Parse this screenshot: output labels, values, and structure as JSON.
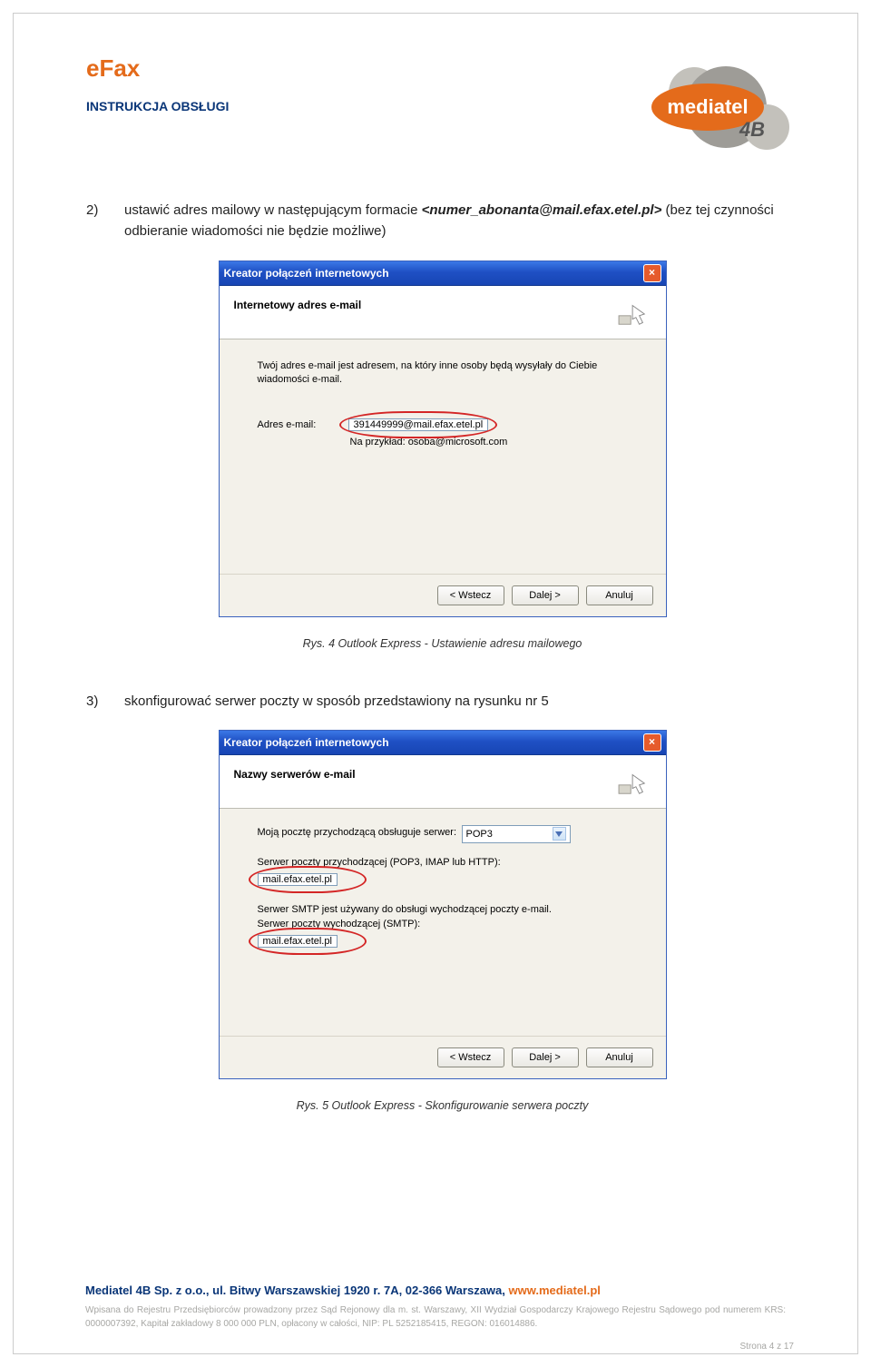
{
  "header": {
    "title": "eFax",
    "subtitle": "INSTRUKCJA OBSŁUGI",
    "logo_main": "mediatel",
    "logo_sub": "4B"
  },
  "step2": {
    "num": "2)",
    "text_a": "ustawić adres mailowy w następującym formacie ",
    "text_italic": "<numer_abonanta@mail.efax.etel.pl>",
    "text_b": " (bez tej czynności odbieranie wiadomości nie będzie możliwe)"
  },
  "dialog1": {
    "title": "Kreator połączeń internetowych",
    "header": "Internetowy adres e-mail",
    "hint": "Twój adres e-mail jest adresem, na który inne osoby będą wysyłały do Ciebie wiadomości e-mail.",
    "field_label": "Adres e-mail:",
    "field_value": "391449999@mail.efax.etel.pl",
    "example": "Na przykład: osoba@microsoft.com",
    "btn_back": "< Wstecz",
    "btn_next": "Dalej >",
    "btn_cancel": "Anuluj",
    "close": "×"
  },
  "caption1": "Rys. 4 Outlook Express - Ustawienie adresu mailowego",
  "step3": {
    "num": "3)",
    "text": "skonfigurować serwer poczty w sposób przedstawiony na rysunku nr 5"
  },
  "dialog2": {
    "title": "Kreator połączeń internetowych",
    "header": "Nazwy serwerów e-mail",
    "label_incoming_proto": "Moją pocztę przychodzącą obsługuje serwer:",
    "proto_value": "POP3",
    "label_incoming": "Serwer poczty przychodzącej (POP3, IMAP lub HTTP):",
    "incoming_value": "mail.efax.etel.pl",
    "smtp_hint": "Serwer SMTP jest używany do obsługi wychodzącej poczty e-mail.",
    "label_outgoing": "Serwer poczty wychodzącej (SMTP):",
    "outgoing_value": "mail.efax.etel.pl",
    "btn_back": "< Wstecz",
    "btn_next": "Dalej >",
    "btn_cancel": "Anuluj",
    "close": "×"
  },
  "caption2": "Rys. 5 Outlook Express - Skonfigurowanie serwera poczty",
  "footer": {
    "line1_a": "Mediatel 4B Sp. z o.o., ul. Bitwy Warszawskiej 1920 r. 7A, 02-366 Warszawa, ",
    "line1_b": "www.mediatel.pl",
    "small": "Wpisana do Rejestru Przedsiębiorców prowadzony przez Sąd Rejonowy dla m. st. Warszawy, XII Wydział Gospodarczy Krajowego Rejestru Sądowego pod numerem KRS: 0000007392, Kapitał zakładowy 8 000 000 PLN, opłacony w całości, NIP: PL 5252185415, REGON: 016014886.",
    "page": "Strona 4 z 17"
  }
}
